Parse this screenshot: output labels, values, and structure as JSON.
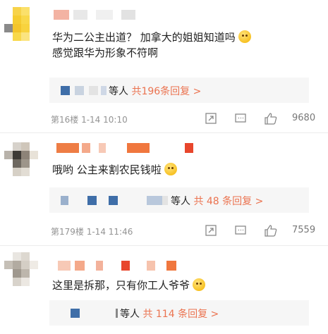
{
  "comments": [
    {
      "text": "华为二公主出道？ 加拿大的姐姐知道吗",
      "text2": "感觉跟华为形象不符啊",
      "reply_prefix": "等人",
      "reply_link": "共196条回复 >",
      "meta": "第16楼 1-14 10:10",
      "likes": "9680",
      "emoji": "grinning-emoji"
    },
    {
      "text": "哦哟 公主来割农民钱啦",
      "reply_prefix": "等人",
      "reply_link": "共 48 条回复 >",
      "meta": "第179楼 1-14 11:46",
      "likes": "7559",
      "emoji": "smiling-emoji"
    },
    {
      "text": "这里是拆那，只有你工人爷爷",
      "reply_prefix": "等人",
      "reply_link": "共 114 条回复 >",
      "emoji": "sweat-smile-emoji"
    }
  ],
  "icons": [
    "share-icon",
    "comment-icon",
    "like-icon"
  ],
  "colors": {
    "accent": "#eb7350",
    "meta": "#939393",
    "reply_bg": "#f6f6f6"
  }
}
